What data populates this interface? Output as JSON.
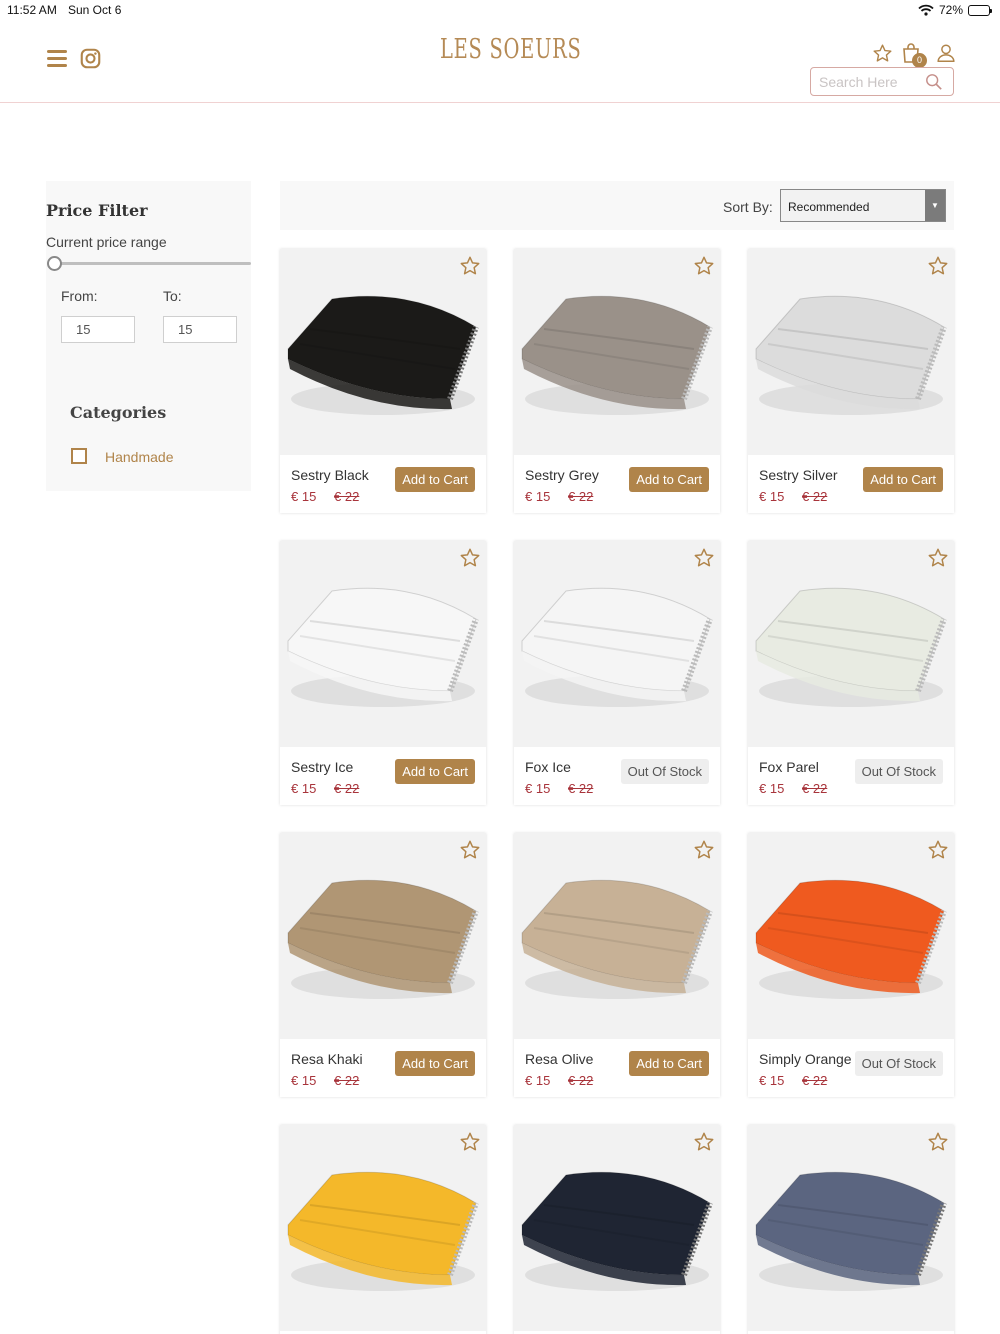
{
  "status": {
    "time": "11:52 AM",
    "date": "Sun Oct 6",
    "battery": "72%"
  },
  "header": {
    "logo_text": "LES SOEURS",
    "cart_count": "0",
    "search_placeholder": "Search Here"
  },
  "sidebar": {
    "price_filter_title": "Price Filter",
    "price_range_label": "Current price range",
    "from_label": "From:",
    "to_label": "To:",
    "from_value": "15",
    "to_value": "15",
    "categories_title": "Categories",
    "categories": [
      {
        "label": "Handmade",
        "checked": false
      }
    ]
  },
  "sort": {
    "label": "Sort By:",
    "selected": "Recommended"
  },
  "colors": {
    "accent": "#b0844a",
    "price": "#a8343b"
  },
  "products": [
    {
      "name": "Sestry Black",
      "price": "€ 15",
      "old_price": "€ 22",
      "action": "Add to Cart",
      "in_stock": true,
      "color": "#1b1a18"
    },
    {
      "name": "Sestry Grey",
      "price": "€ 15",
      "old_price": "€ 22",
      "action": "Add to Cart",
      "in_stock": true,
      "color": "#9a9189"
    },
    {
      "name": "Sestry Silver",
      "price": "€ 15",
      "old_price": "€ 22",
      "action": "Add to Cart",
      "in_stock": true,
      "color": "#dcdcdc"
    },
    {
      "name": "Sestry Ice",
      "price": "€ 15",
      "old_price": "€ 22",
      "action": "Add to Cart",
      "in_stock": true,
      "color": "#f7f7f7"
    },
    {
      "name": "Fox Ice",
      "price": "€ 15",
      "old_price": "€ 22",
      "action": "Out Of Stock",
      "in_stock": false,
      "color": "#f5f5f5"
    },
    {
      "name": "Fox Parel",
      "price": "€ 15",
      "old_price": "€ 22",
      "action": "Out Of Stock",
      "in_stock": false,
      "color": "#e8ebe2"
    },
    {
      "name": "Resa Khaki",
      "price": "€ 15",
      "old_price": "€ 22",
      "action": "Add to Cart",
      "in_stock": true,
      "color": "#b09674"
    },
    {
      "name": "Resa Olive",
      "price": "€ 15",
      "old_price": "€ 22",
      "action": "Add to Cart",
      "in_stock": true,
      "color": "#c7b196"
    },
    {
      "name": "Simply Orange",
      "price": "€ 15",
      "old_price": "€ 22",
      "action": "Out Of Stock",
      "in_stock": false,
      "color": "#ef5a1f"
    },
    {
      "name": "",
      "price": "",
      "old_price": "",
      "action": "",
      "in_stock": true,
      "color": "#f4b82a"
    },
    {
      "name": "",
      "price": "",
      "old_price": "",
      "action": "",
      "in_stock": true,
      "color": "#1f2533"
    },
    {
      "name": "",
      "price": "",
      "old_price": "",
      "action": "",
      "in_stock": true,
      "color": "#5b6580"
    }
  ]
}
